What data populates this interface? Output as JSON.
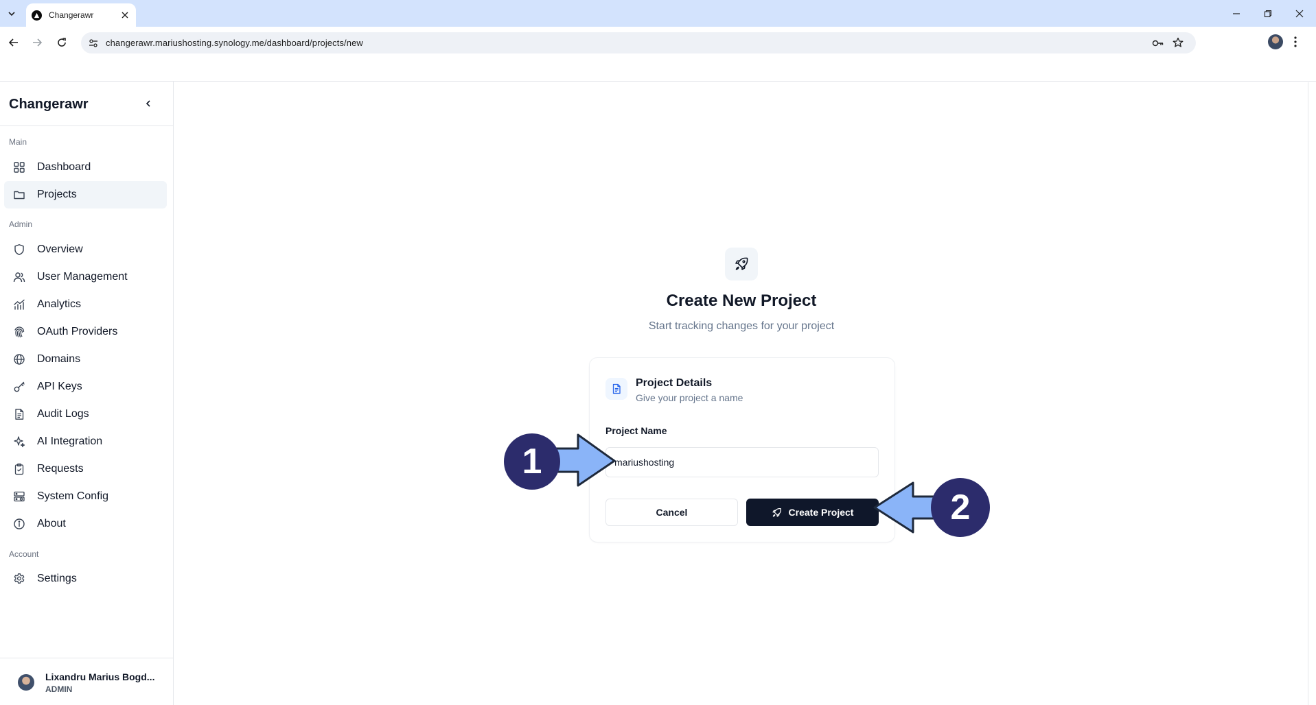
{
  "browser": {
    "tab_title": "Changerawr",
    "url": "changerawr.mariushosting.synology.me/dashboard/projects/new"
  },
  "sidebar": {
    "brand": "Changerawr",
    "sections": {
      "main": "Main",
      "admin": "Admin",
      "account": "Account"
    },
    "items": [
      {
        "label": "Dashboard",
        "icon": "grid-icon"
      },
      {
        "label": "Projects",
        "icon": "folder-icon",
        "active": true
      },
      {
        "label": "Overview",
        "icon": "shield-icon"
      },
      {
        "label": "User Management",
        "icon": "users-icon"
      },
      {
        "label": "Analytics",
        "icon": "chart-icon"
      },
      {
        "label": "OAuth Providers",
        "icon": "fingerprint-icon"
      },
      {
        "label": "Domains",
        "icon": "globe-icon"
      },
      {
        "label": "API Keys",
        "icon": "key-icon"
      },
      {
        "label": "Audit Logs",
        "icon": "file-text-icon"
      },
      {
        "label": "AI Integration",
        "icon": "sparkles-icon"
      },
      {
        "label": "Requests",
        "icon": "clipboard-check-icon"
      },
      {
        "label": "System Config",
        "icon": "server-cog-icon"
      },
      {
        "label": "About",
        "icon": "info-icon"
      },
      {
        "label": "Settings",
        "icon": "gear-icon"
      }
    ],
    "user": {
      "name": "Lixandru Marius Bogd...",
      "role": "ADMIN"
    }
  },
  "main": {
    "title": "Create New Project",
    "subtitle": "Start tracking changes for your project",
    "card": {
      "title": "Project Details",
      "description": "Give your project a name",
      "field_label": "Project Name",
      "field_value": "mariushosting",
      "cancel_label": "Cancel",
      "create_label": "Create Project"
    }
  },
  "annotations": {
    "step1": "1",
    "step2": "2",
    "arrow_color": "#8ab4f8",
    "badge_color": "#2c2c6c"
  }
}
